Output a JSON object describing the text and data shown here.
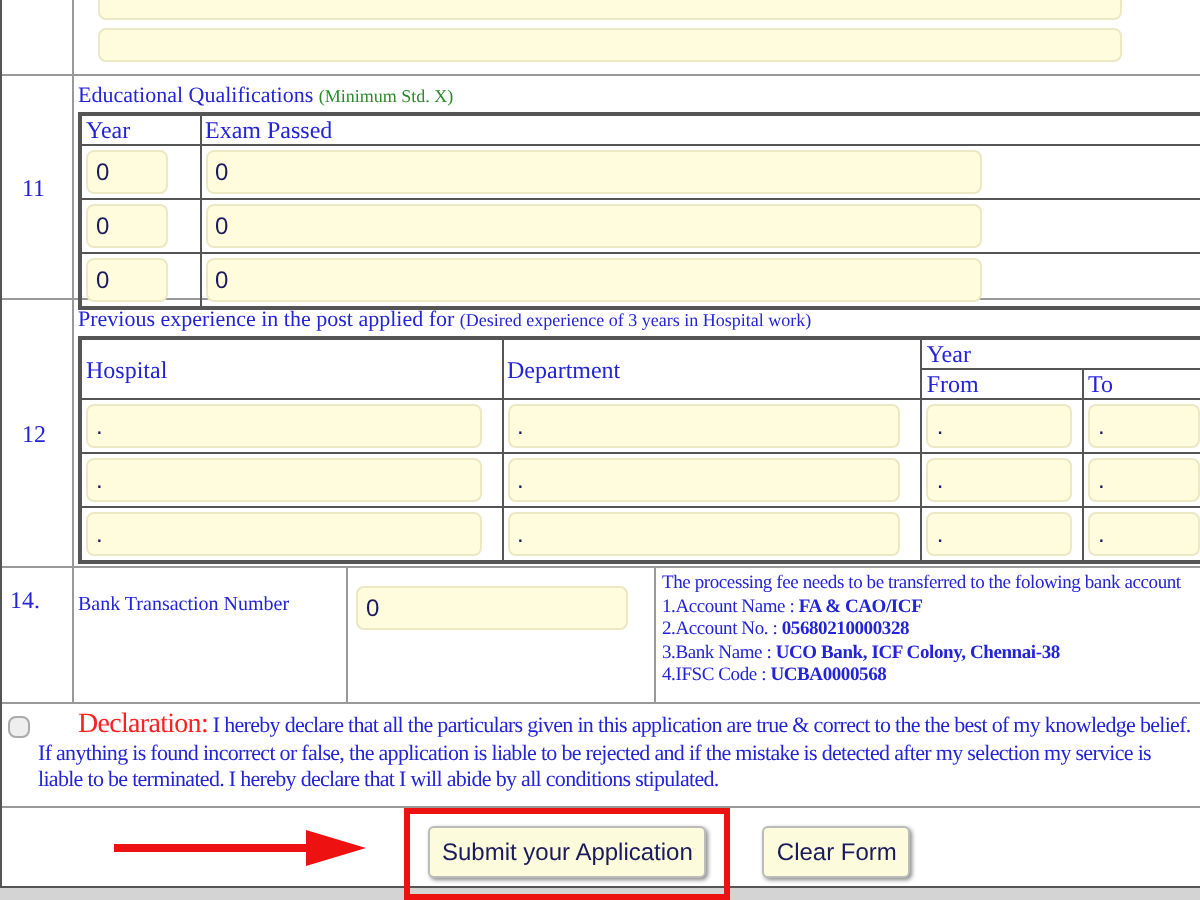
{
  "education": {
    "number": "11",
    "title": "Educational Qualifications",
    "note": "(Minimum Std. X)",
    "columns": [
      "Year",
      "Exam Passed"
    ],
    "rows": [
      {
        "year": "0",
        "exam": "0"
      },
      {
        "year": "0",
        "exam": "0"
      },
      {
        "year": "0",
        "exam": "0"
      }
    ]
  },
  "experience": {
    "number": "12",
    "title": "Previous experience in the post applied for",
    "note": "(Desired experience of 3 years in Hospital work)",
    "columns": {
      "hospital": "Hospital",
      "department": "Department",
      "year": "Year",
      "from": "From",
      "to": "To"
    },
    "rows": [
      {
        "hospital": ".",
        "department": ".",
        "from": ".",
        "to": "."
      },
      {
        "hospital": ".",
        "department": ".",
        "from": ".",
        "to": "."
      },
      {
        "hospital": ".",
        "department": ".",
        "from": ".",
        "to": "."
      }
    ]
  },
  "bank": {
    "number": "14.",
    "label": "Bank Transaction Number",
    "value": "0",
    "info_lines": [
      "The processing fee needs to be transferred to the folowing bank account",
      "1.Account Name : **FA & CAO/ICF**",
      "2.Account No. : **05680210000328**",
      "3.Bank Name : **UCO Bank, ICF Colony, Chennai-38**",
      "4.IFSC Code : **UCBA0000568**"
    ]
  },
  "declaration": {
    "checked": false,
    "label": "Declaration:",
    "text": "I hereby declare that all the particulars given in this application are true & correct to the the best of my knowledge belief. If anything is found incorrect or false, the application is liable to be rejected and if the mistake is detected after my selection my service is liable to be terminated. I hereby declare that I will abide by all conditions stipulated."
  },
  "buttons": [
    {
      "label": "Submit your Application",
      "highlighted": true
    },
    {
      "label": "Clear Form",
      "highlighted": false
    }
  ]
}
